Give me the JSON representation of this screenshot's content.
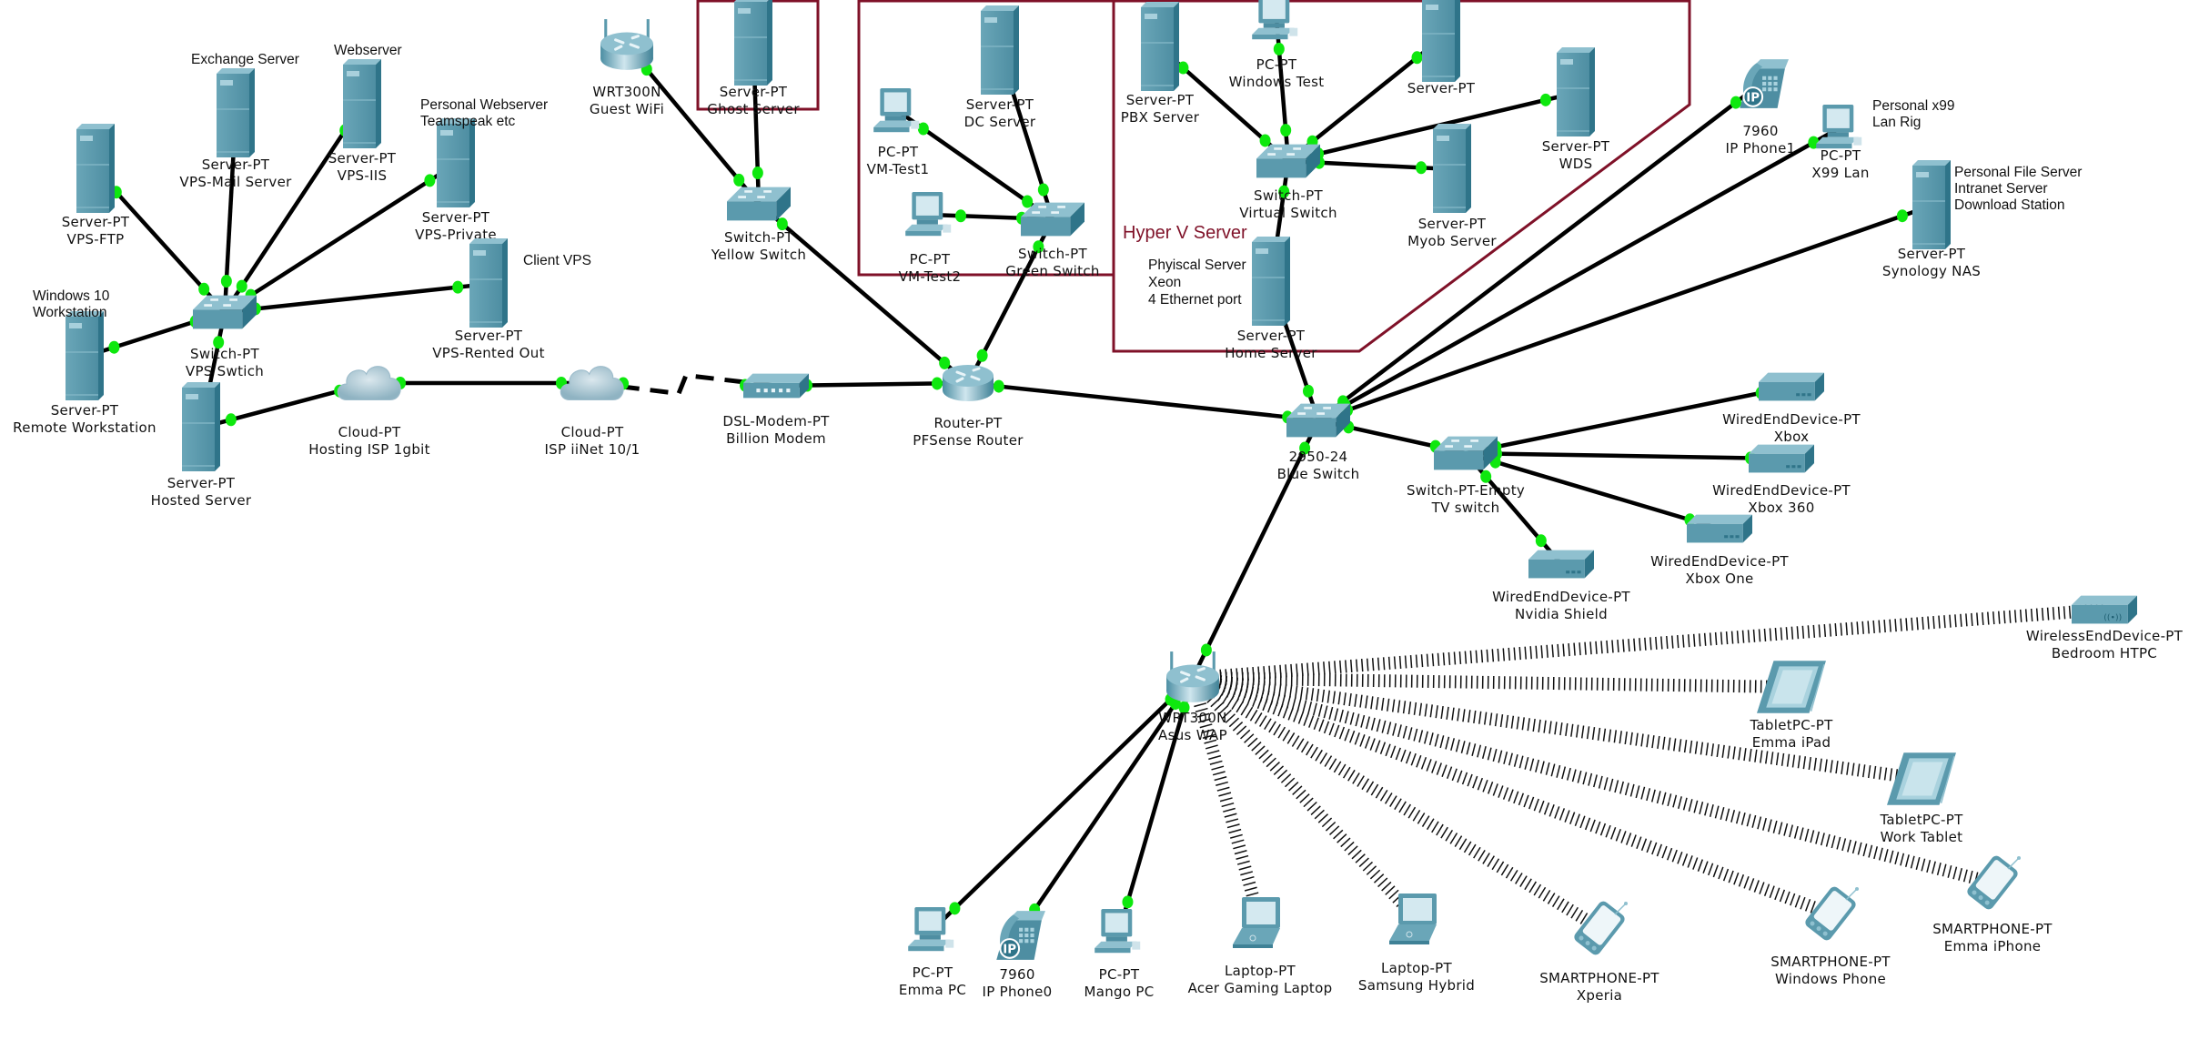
{
  "colors": {
    "device": "#5b9aad",
    "device_dark": "#2f7489",
    "device_light": "#8fc0cf",
    "link": "#000000",
    "port_up": "#0ee80e",
    "area_border": "#7f1128"
  },
  "areas": [
    {
      "id": "ghost-area",
      "label": ""
    },
    {
      "id": "green-area",
      "label": ""
    },
    {
      "id": "hyperv-area",
      "label": "Hyper V Server"
    }
  ],
  "notes": [
    {
      "id": "note-exchange",
      "lines": [
        "Exchange Server"
      ]
    },
    {
      "id": "note-webserver",
      "lines": [
        "Webserver"
      ]
    },
    {
      "id": "note-personal-web",
      "lines": [
        "Personal Webserver",
        "Teamspeak etc"
      ]
    },
    {
      "id": "note-client-vps",
      "lines": [
        "Client VPS"
      ]
    },
    {
      "id": "note-win10",
      "lines": [
        "Windows 10",
        "Workstation"
      ]
    },
    {
      "id": "note-physical",
      "lines": [
        "Phyiscal Server",
        "Xeon",
        "4 Ethernet port"
      ]
    },
    {
      "id": "note-x99",
      "lines": [
        "Personal x99",
        "Lan Rig"
      ]
    },
    {
      "id": "note-nas",
      "lines": [
        "Personal File Server",
        "Intranet Server",
        "Download Station"
      ]
    }
  ],
  "devices": [
    {
      "id": "vps-ftp",
      "type": "server",
      "model": "Server-PT",
      "name": "VPS-FTP"
    },
    {
      "id": "vps-mail",
      "type": "server",
      "model": "Server-PT",
      "name": "VPS-Mail Server"
    },
    {
      "id": "vps-iis",
      "type": "server",
      "model": "Server-PT",
      "name": "VPS-IIS"
    },
    {
      "id": "vps-private",
      "type": "server",
      "model": "Server-PT",
      "name": "VPS-Private"
    },
    {
      "id": "vps-rented",
      "type": "server",
      "model": "Server-PT",
      "name": "VPS-Rented Out"
    },
    {
      "id": "vps-switch",
      "type": "switch",
      "model": "Switch-PT",
      "name": "VPS Swtich"
    },
    {
      "id": "remote-ws",
      "type": "server",
      "model": "Server-PT",
      "name": "Remote Workstation"
    },
    {
      "id": "hosted-server",
      "type": "server",
      "model": "Server-PT",
      "name": "Hosted Server"
    },
    {
      "id": "cloud-hosting",
      "type": "cloud",
      "model": "Cloud-PT",
      "name": "Hosting ISP 1gbit"
    },
    {
      "id": "cloud-iinet",
      "type": "cloud",
      "model": "Cloud-PT",
      "name": "ISP iiNet 10/1"
    },
    {
      "id": "dsl-modem",
      "type": "modem",
      "model": "DSL-Modem-PT",
      "name": "Billion Modem"
    },
    {
      "id": "pfsense",
      "type": "router",
      "model": "Router-PT",
      "name": "PFSense Router"
    },
    {
      "id": "guest-wifi",
      "type": "wrouter",
      "model": "WRT300N",
      "name": "Guest WiFi"
    },
    {
      "id": "ghost-server",
      "type": "server",
      "model": "Server-PT",
      "name": "Ghost Server"
    },
    {
      "id": "yellow-switch",
      "type": "switch",
      "model": "Switch-PT",
      "name": "Yellow Switch"
    },
    {
      "id": "dc-server",
      "type": "server",
      "model": "Server-PT",
      "name": "DC Server"
    },
    {
      "id": "vm-test1",
      "type": "pc",
      "model": "PC-PT",
      "name": "VM-Test1"
    },
    {
      "id": "vm-test2",
      "type": "pc",
      "model": "PC-PT",
      "name": "VM-Test2"
    },
    {
      "id": "green-switch",
      "type": "switch",
      "model": "Switch-PT",
      "name": "Green Switch"
    },
    {
      "id": "pbx-server",
      "type": "server",
      "model": "Server-PT",
      "name": "PBX Server"
    },
    {
      "id": "windows-test",
      "type": "pc",
      "model": "PC-PT",
      "name": "Windows Test"
    },
    {
      "id": "server-top",
      "type": "server",
      "model": "Server-PT",
      "name": ""
    },
    {
      "id": "wds",
      "type": "server",
      "model": "Server-PT",
      "name": "WDS"
    },
    {
      "id": "virtual-switch",
      "type": "switch",
      "model": "Switch-PT",
      "name": "Virtual Switch"
    },
    {
      "id": "myob-server",
      "type": "server",
      "model": "Server-PT",
      "name": "Myob Server"
    },
    {
      "id": "home-server",
      "type": "server",
      "model": "Server-PT",
      "name": "Home Server"
    },
    {
      "id": "blue-switch",
      "type": "switch",
      "model": "2950-24",
      "name": "Blue Switch"
    },
    {
      "id": "ip-phone1",
      "type": "phone",
      "model": "7960",
      "name": "IP Phone1"
    },
    {
      "id": "x99-lan",
      "type": "pc",
      "model": "PC-PT",
      "name": "X99 Lan"
    },
    {
      "id": "synology",
      "type": "server",
      "model": "Server-PT",
      "name": "Synology NAS"
    },
    {
      "id": "tv-switch",
      "type": "switch",
      "model": "Switch-PT-Empty",
      "name": "TV switch"
    },
    {
      "id": "xbox",
      "type": "wired",
      "model": "WiredEndDevice-PT",
      "name": "Xbox"
    },
    {
      "id": "xbox360",
      "type": "wired",
      "model": "WiredEndDevice-PT",
      "name": "Xbox 360"
    },
    {
      "id": "xbox-one",
      "type": "wired",
      "model": "WiredEndDevice-PT",
      "name": "Xbox One"
    },
    {
      "id": "nvidia-shield",
      "type": "wired",
      "model": "WiredEndDevice-PT",
      "name": "Nvidia Shield"
    },
    {
      "id": "asus-wap",
      "type": "wrouter",
      "model": "WRT300N",
      "name": "Asus WAP"
    },
    {
      "id": "bedroom-htpc",
      "type": "wireless-end",
      "model": "WirelessEndDevice-PT",
      "name": "Bedroom HTPC"
    },
    {
      "id": "emma-ipad",
      "type": "tablet",
      "model": "TabletPC-PT",
      "name": "Emma iPad"
    },
    {
      "id": "work-tablet",
      "type": "tablet",
      "model": "TabletPC-PT",
      "name": "Work Tablet"
    },
    {
      "id": "emma-iphone",
      "type": "smartphone",
      "model": "SMARTPHONE-PT",
      "name": "Emma iPhone"
    },
    {
      "id": "windows-phone",
      "type": "smartphone",
      "model": "SMARTPHONE-PT",
      "name": "Windows Phone"
    },
    {
      "id": "xperia",
      "type": "smartphone",
      "model": "SMARTPHONE-PT",
      "name": "Xperia"
    },
    {
      "id": "samsung-hybrid",
      "type": "laptop",
      "model": "Laptop-PT",
      "name": "Samsung Hybrid"
    },
    {
      "id": "acer-laptop",
      "type": "laptop",
      "model": "Laptop-PT",
      "name": "Acer Gaming Laptop"
    },
    {
      "id": "mango-pc",
      "type": "pc",
      "model": "PC-PT",
      "name": "Mango PC"
    },
    {
      "id": "ip-phone0",
      "type": "phone",
      "model": "7960",
      "name": "IP Phone0"
    },
    {
      "id": "emma-pc",
      "type": "pc",
      "model": "PC-PT",
      "name": "Emma PC"
    }
  ],
  "links": [
    {
      "from": "vps-ftp",
      "to": "vps-switch",
      "kind": "ethernet"
    },
    {
      "from": "vps-mail",
      "to": "vps-switch",
      "kind": "ethernet"
    },
    {
      "from": "vps-iis",
      "to": "vps-switch",
      "kind": "ethernet"
    },
    {
      "from": "vps-private",
      "to": "vps-switch",
      "kind": "ethernet"
    },
    {
      "from": "vps-rented",
      "to": "vps-switch",
      "kind": "ethernet"
    },
    {
      "from": "remote-ws",
      "to": "vps-switch",
      "kind": "ethernet"
    },
    {
      "from": "hosted-server",
      "to": "vps-switch",
      "kind": "ethernet"
    },
    {
      "from": "hosted-server",
      "to": "cloud-hosting",
      "kind": "ethernet"
    },
    {
      "from": "cloud-hosting",
      "to": "cloud-iinet",
      "kind": "ethernet"
    },
    {
      "from": "cloud-iinet",
      "to": "dsl-modem",
      "kind": "serial"
    },
    {
      "from": "dsl-modem",
      "to": "pfsense",
      "kind": "ethernet"
    },
    {
      "from": "guest-wifi",
      "to": "yellow-switch",
      "kind": "ethernet"
    },
    {
      "from": "ghost-server",
      "to": "yellow-switch",
      "kind": "ethernet"
    },
    {
      "from": "yellow-switch",
      "to": "pfsense",
      "kind": "ethernet"
    },
    {
      "from": "dc-server",
      "to": "green-switch",
      "kind": "ethernet"
    },
    {
      "from": "vm-test1",
      "to": "green-switch",
      "kind": "ethernet"
    },
    {
      "from": "vm-test2",
      "to": "green-switch",
      "kind": "ethernet"
    },
    {
      "from": "green-switch",
      "to": "pfsense",
      "kind": "ethernet"
    },
    {
      "from": "pfsense",
      "to": "blue-switch",
      "kind": "ethernet"
    },
    {
      "from": "pbx-server",
      "to": "virtual-switch",
      "kind": "ethernet"
    },
    {
      "from": "windows-test",
      "to": "virtual-switch",
      "kind": "ethernet"
    },
    {
      "from": "server-top",
      "to": "virtual-switch",
      "kind": "ethernet"
    },
    {
      "from": "wds",
      "to": "virtual-switch",
      "kind": "ethernet"
    },
    {
      "from": "myob-server",
      "to": "virtual-switch",
      "kind": "ethernet"
    },
    {
      "from": "home-server",
      "to": "virtual-switch",
      "kind": "ethernet"
    },
    {
      "from": "home-server",
      "to": "blue-switch",
      "kind": "ethernet"
    },
    {
      "from": "ip-phone1",
      "to": "blue-switch",
      "kind": "ethernet"
    },
    {
      "from": "x99-lan",
      "to": "blue-switch",
      "kind": "ethernet"
    },
    {
      "from": "synology",
      "to": "blue-switch",
      "kind": "ethernet"
    },
    {
      "from": "tv-switch",
      "to": "blue-switch",
      "kind": "ethernet"
    },
    {
      "from": "tv-switch",
      "to": "xbox",
      "kind": "ethernet"
    },
    {
      "from": "tv-switch",
      "to": "xbox360",
      "kind": "ethernet"
    },
    {
      "from": "tv-switch",
      "to": "xbox-one",
      "kind": "ethernet"
    },
    {
      "from": "tv-switch",
      "to": "nvidia-shield",
      "kind": "ethernet"
    },
    {
      "from": "blue-switch",
      "to": "asus-wap",
      "kind": "ethernet"
    },
    {
      "from": "asus-wap",
      "to": "emma-pc",
      "kind": "ethernet"
    },
    {
      "from": "asus-wap",
      "to": "ip-phone0",
      "kind": "ethernet"
    },
    {
      "from": "asus-wap",
      "to": "mango-pc",
      "kind": "ethernet"
    },
    {
      "from": "asus-wap",
      "to": "acer-laptop",
      "kind": "wireless"
    },
    {
      "from": "asus-wap",
      "to": "samsung-hybrid",
      "kind": "wireless"
    },
    {
      "from": "asus-wap",
      "to": "xperia",
      "kind": "wireless"
    },
    {
      "from": "asus-wap",
      "to": "windows-phone",
      "kind": "wireless"
    },
    {
      "from": "asus-wap",
      "to": "emma-iphone",
      "kind": "wireless"
    },
    {
      "from": "asus-wap",
      "to": "work-tablet",
      "kind": "wireless"
    },
    {
      "from": "asus-wap",
      "to": "emma-ipad",
      "kind": "wireless"
    },
    {
      "from": "asus-wap",
      "to": "bedroom-htpc",
      "kind": "wireless"
    }
  ]
}
